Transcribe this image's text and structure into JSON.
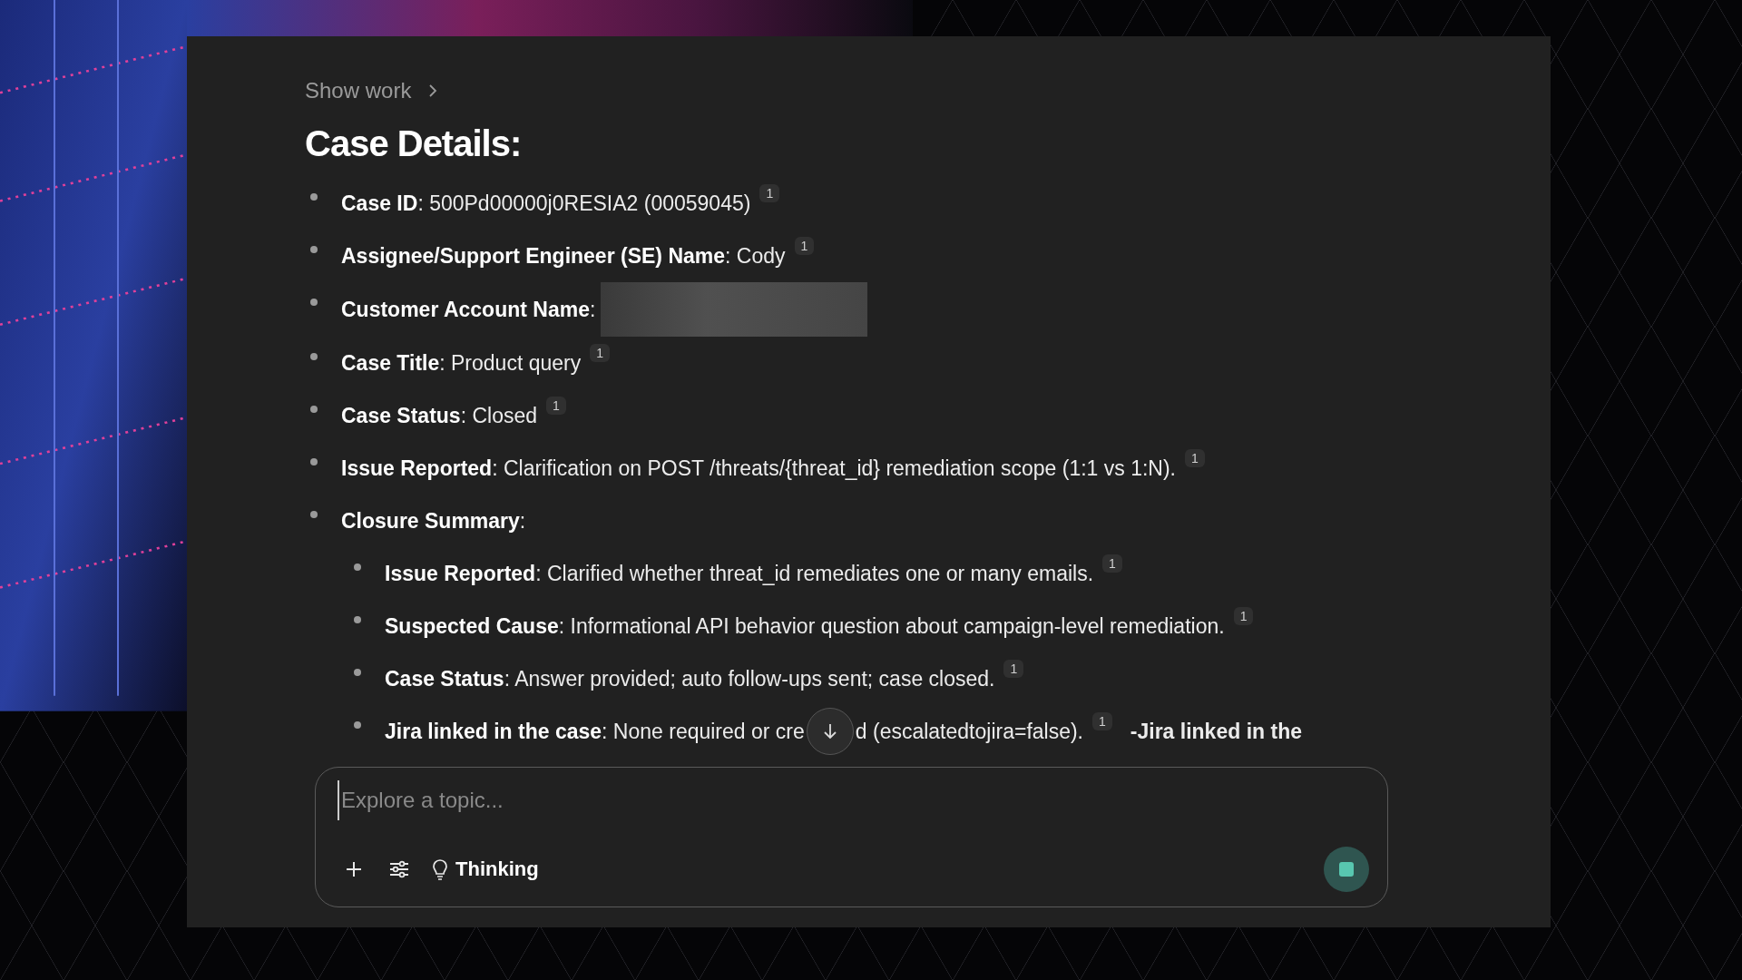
{
  "show_work": {
    "label": "Show work",
    "expanded": false
  },
  "heading": "Case Details:",
  "items": [
    {
      "text": "**Case ID**: 500Pd00000j0RESIA2 (00059045)",
      "citation": "1"
    },
    {
      "text": "**Assignee/Support Engineer (SE) Name**: Cody",
      "citation": "1"
    },
    {
      "text": "**Customer Account Name**:",
      "redacted": true
    },
    {
      "text": "**Case Title**: Product query",
      "citation": "1"
    },
    {
      "text": "**Case Status**: Closed",
      "citation": "1"
    },
    {
      "text": "**Issue Reported**: Clarification on POST /threats/{threat_id} remediation scope (1:1 vs 1:N).",
      "citation": "1"
    },
    {
      "text": "**Closure Summary**:",
      "children": [
        {
          "text": "**Issue Reported**: Clarified whether threat_id remediates one or many emails.",
          "citation": "1"
        },
        {
          "text": "**Suspected Cause**: Informational API behavior question about campaign-level remediation.",
          "citation": "1"
        },
        {
          "text": "**Case Status**: Answer provided; auto follow-ups sent; case closed.",
          "citation": "1"
        },
        {
          "text": "**Jira linked in the case**: None required or cre",
          "text_after": "d (escalatedtojira=false).",
          "citation": "1",
          "trailing": "-Jira linked in the"
        }
      ]
    }
  ],
  "composer": {
    "placeholder": "Explore a topic...",
    "mode": "Thinking",
    "busy": true
  }
}
